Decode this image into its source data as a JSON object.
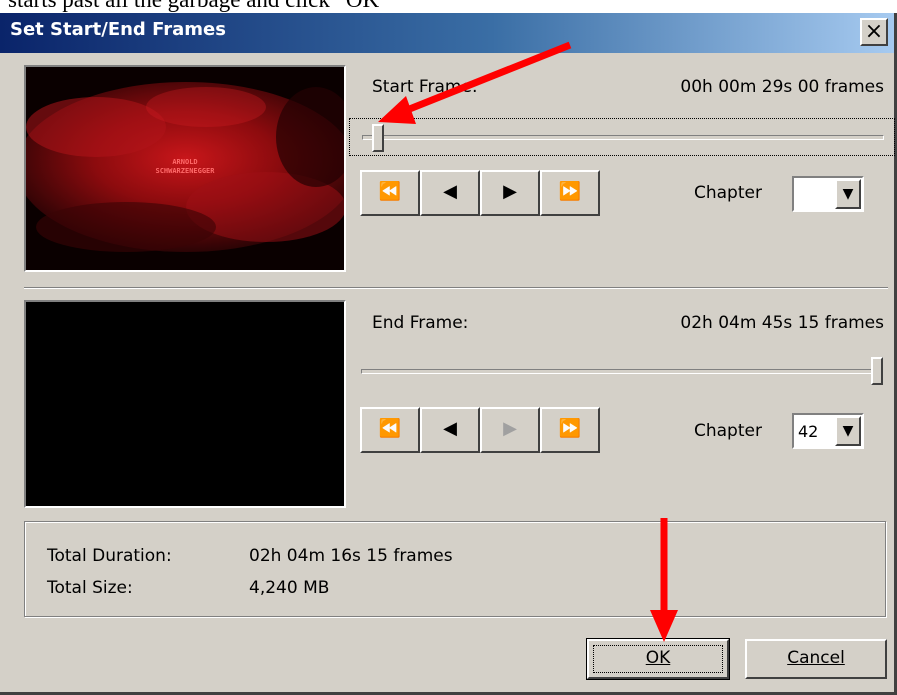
{
  "caption": "starts past all the garbage and click “OK”",
  "window": {
    "title": "Set Start/End Frames",
    "close_glyph": "×"
  },
  "start": {
    "label": "Start Frame:",
    "time": "00h 00m 29s 00 frames",
    "slider_position": 0.02,
    "chapter_label": "Chapter",
    "chapter_value": "",
    "preview_text": [
      "ARNOLD",
      "SCHWARZENEGGER"
    ],
    "nav": [
      "⏪",
      "◀",
      "▶",
      "⏩"
    ]
  },
  "end": {
    "label": "End Frame:",
    "time": "02h 04m 45s 15 frames",
    "slider_position": 1.0,
    "chapter_label": "Chapter",
    "chapter_value": "42",
    "nav": [
      "⏪",
      "◀",
      "▶",
      "⏩"
    ],
    "nav_disabled": [
      false,
      false,
      true,
      true
    ]
  },
  "summary": {
    "duration_label": "Total Duration:",
    "duration_value": "02h 04m 16s 15 frames",
    "size_label": "Total Size:",
    "size_value": "4,240 MB"
  },
  "buttons": {
    "ok": "OK",
    "cancel": "Cancel"
  },
  "colors": {
    "annotation_arrow": "#ff0000",
    "title_gradient_start": "#0a246a",
    "title_gradient_end": "#a6caf0",
    "dialog_bg": "#d4d0c8"
  },
  "icons": {
    "dropdown": "▼"
  }
}
